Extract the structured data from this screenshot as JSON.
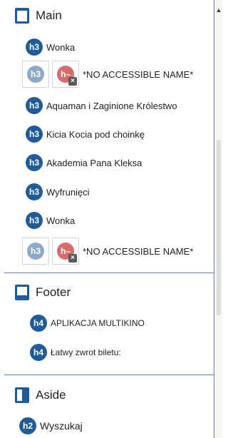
{
  "main": {
    "label": "Main",
    "items": [
      {
        "level": "h3",
        "text": "Wonka"
      },
      {
        "level": "h3",
        "err_level": "h–",
        "text": "*NO ACCESSIBLE NAME*"
      },
      {
        "level": "h3",
        "text": "Aquaman i Zaginione Królestwo"
      },
      {
        "level": "h3",
        "text": "Kicia Kocia pod choinkę"
      },
      {
        "level": "h3",
        "text": "Akademia Pana Kleksa"
      },
      {
        "level": "h3",
        "text": "Wyfrunięci"
      },
      {
        "level": "h3",
        "text": "Wonka"
      },
      {
        "level": "h3",
        "err_level": "h–",
        "text": "*NO ACCESSIBLE NAME*"
      }
    ]
  },
  "footer": {
    "label": "Footer",
    "items": [
      {
        "level": "h4",
        "text": "APLIKACJA MULTIKINO"
      },
      {
        "level": "h4",
        "text": "Łatwy zwrot biletu:"
      }
    ]
  },
  "aside": {
    "label": "Aside",
    "items": [
      {
        "level": "h2",
        "text": "Wyszukaj"
      }
    ]
  },
  "colors": {
    "heading_badge": "#1f5c99",
    "separator": "#5b7fc7",
    "error_badge": "#d96b6b"
  },
  "icons": {
    "main": "main-landmark-icon",
    "footer": "footer-landmark-icon",
    "aside": "aside-landmark-icon"
  }
}
